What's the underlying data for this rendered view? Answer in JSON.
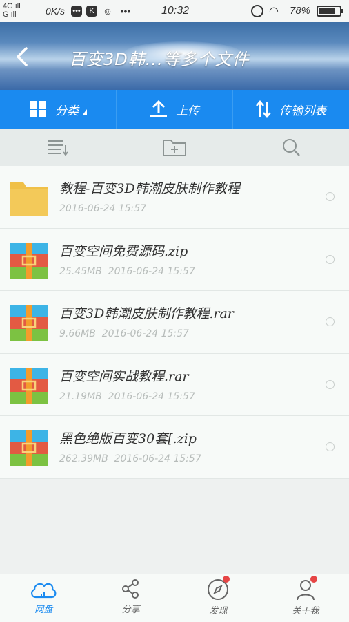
{
  "status_bar": {
    "network": "4G",
    "network_2": "G",
    "speed": "0K/s",
    "time": "10:32",
    "battery": "78%",
    "battery_level": 0.78
  },
  "header": {
    "title": "百变3D韩...等多个文件"
  },
  "toolbar": {
    "classify_label": "分类",
    "upload_label": "上传",
    "transfer_label": "传输列表"
  },
  "files": [
    {
      "name": "教程-百变3D韩潮皮肤制作教程",
      "size": "",
      "date": "2016-06-24  15:57",
      "type": "folder"
    },
    {
      "name": "百变空间免费源码.zip",
      "size": "25.45MB",
      "date": "2016-06-24  15:57",
      "type": "archive"
    },
    {
      "name": "百变3D韩潮皮肤制作教程.rar",
      "size": "9.66MB",
      "date": "2016-06-24  15:57",
      "type": "archive"
    },
    {
      "name": "百变空间实战教程.rar",
      "size": "21.19MB",
      "date": "2016-06-24  15:57",
      "type": "archive"
    },
    {
      "name": "黑色绝版百变30套[.zip",
      "size": "262.39MB",
      "date": "2016-06-24  15:57",
      "type": "archive"
    }
  ],
  "bottom_nav": {
    "items": [
      {
        "label": "网盘",
        "icon": "cloud-icon",
        "active": true
      },
      {
        "label": "分享",
        "icon": "share-icon",
        "active": false
      },
      {
        "label": "发现",
        "icon": "compass-icon",
        "active": false,
        "badge": true
      },
      {
        "label": "关于我",
        "icon": "user-icon",
        "active": false,
        "badge": true
      }
    ]
  },
  "colors": {
    "accent": "#1a8af0",
    "badge": "#e64545",
    "folder": "#f0c048"
  }
}
